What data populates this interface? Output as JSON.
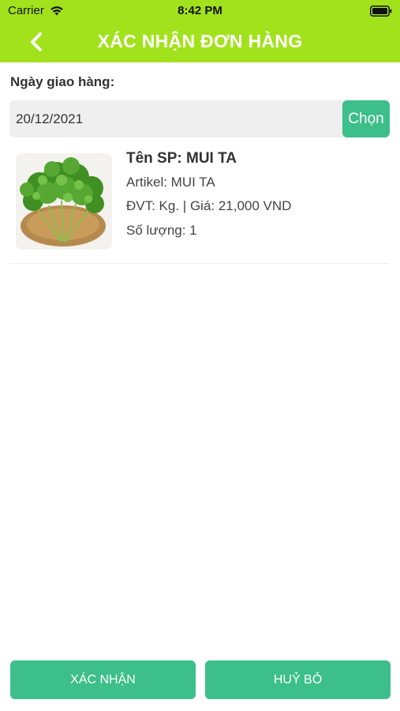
{
  "status_bar": {
    "carrier": "Carrier",
    "time": "8:42 PM"
  },
  "header": {
    "title": "XÁC NHẬN ĐƠN HÀNG",
    "back_icon": "chevron-left-icon",
    "background_color": "#a2e21c"
  },
  "delivery": {
    "label": "Ngày giao hàng:",
    "date_value": "20/12/2021",
    "choose_label": "Chọn"
  },
  "products": [
    {
      "image": "parsley-image",
      "name": "Tên SP: MUI TA",
      "artikel": "Artikel: MUI TA",
      "unit_price": "ĐVT: Kg.  |  Giá: 21,000 VND",
      "quantity": "Số lượng: 1"
    }
  ],
  "actions": {
    "confirm_label": "XÁC NHẬN",
    "cancel_label": "HUỶ BỎ",
    "button_color": "#3cbf8a"
  }
}
